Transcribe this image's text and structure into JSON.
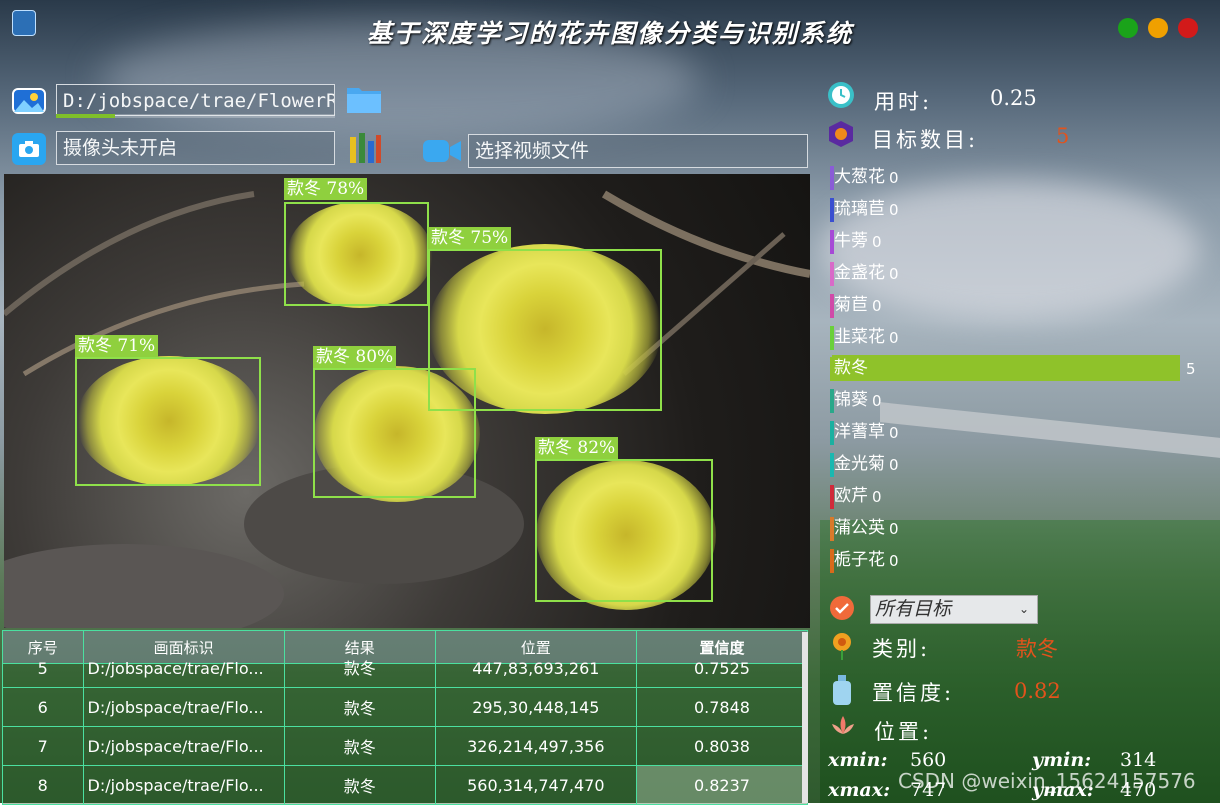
{
  "window": {
    "title": "基于深度学习的花卉图像分类与识别系统",
    "controls": [
      {
        "name": "minimize",
        "color": "#1aa31a"
      },
      {
        "name": "maximize",
        "color": "#f0a000"
      },
      {
        "name": "close",
        "color": "#d21a1a"
      }
    ]
  },
  "inputs": {
    "image_path": "D:/jobspace/trae/FlowerRe",
    "image_progress": 0.21,
    "camera_status": "摄像头未开启",
    "video_placeholder": "选择视频文件"
  },
  "detections": [
    {
      "label": "款冬 78%"
    },
    {
      "label": "款冬 75%"
    },
    {
      "label": "款冬 71%"
    },
    {
      "label": "款冬 80%"
    },
    {
      "label": "款冬 82%"
    }
  ],
  "table": {
    "headers": [
      "序号",
      "画面标识",
      "结果",
      "位置",
      "置信度"
    ],
    "rows": [
      {
        "index": "5",
        "source": "D:/jobspace/trae/Flo...",
        "result": "款冬",
        "position": "447,83,693,261",
        "confidence": "0.7525"
      },
      {
        "index": "6",
        "source": "D:/jobspace/trae/Flo...",
        "result": "款冬",
        "position": "295,30,448,145",
        "confidence": "0.7848"
      },
      {
        "index": "7",
        "source": "D:/jobspace/trae/Flo...",
        "result": "款冬",
        "position": "326,214,497,356",
        "confidence": "0.8038"
      },
      {
        "index": "8",
        "source": "D:/jobspace/trae/Flo...",
        "result": "款冬",
        "position": "560,314,747,470",
        "confidence": "0.8237"
      }
    ]
  },
  "stats": {
    "time_label": "用时:",
    "time_value": "0.25",
    "count_label": "目标数目:",
    "count_value": "5",
    "count_color": "#e2531c"
  },
  "classes": [
    {
      "name": "大葱花",
      "count": 0,
      "color": "#8a5cd6"
    },
    {
      "name": "琉璃苣",
      "count": 0,
      "color": "#3a4fd0"
    },
    {
      "name": "牛蒡",
      "count": 0,
      "color": "#a64ad6"
    },
    {
      "name": "金盏花",
      "count": 0,
      "color": "#d86ac8"
    },
    {
      "name": "菊苣",
      "count": 0,
      "color": "#d04aa8"
    },
    {
      "name": "韭菜花",
      "count": 0,
      "color": "#6ad03a"
    },
    {
      "name": "款冬",
      "count": 5,
      "color": "#8fc22a"
    },
    {
      "name": "锦葵",
      "count": 0,
      "color": "#2aa88a"
    },
    {
      "name": "洋蓍草",
      "count": 0,
      "color": "#1ab0a0"
    },
    {
      "name": "金光菊",
      "count": 0,
      "color": "#1ab8b0"
    },
    {
      "name": "欧芹",
      "count": 0,
      "color": "#d02a3a"
    },
    {
      "name": "蒲公英",
      "count": 0,
      "color": "#d87a2a"
    },
    {
      "name": "栀子花",
      "count": 0,
      "color": "#d86a1a"
    }
  ],
  "detail": {
    "filter_selected": "所有目标",
    "class_label": "类别:",
    "class_value": "款冬",
    "confidence_label": "置信度:",
    "confidence_value": "0.82",
    "position_label": "位置:",
    "xmin_label": "xmin:",
    "xmin_value": "560",
    "ymin_label": "ymin:",
    "ymin_value": "314",
    "xmax_label": "xmax:",
    "xmax_value": "747",
    "ymax_label": "ymax:",
    "ymax_value": "470",
    "value_color": "#e2531c"
  },
  "watermark": "CSDN @weixin_15624157576"
}
